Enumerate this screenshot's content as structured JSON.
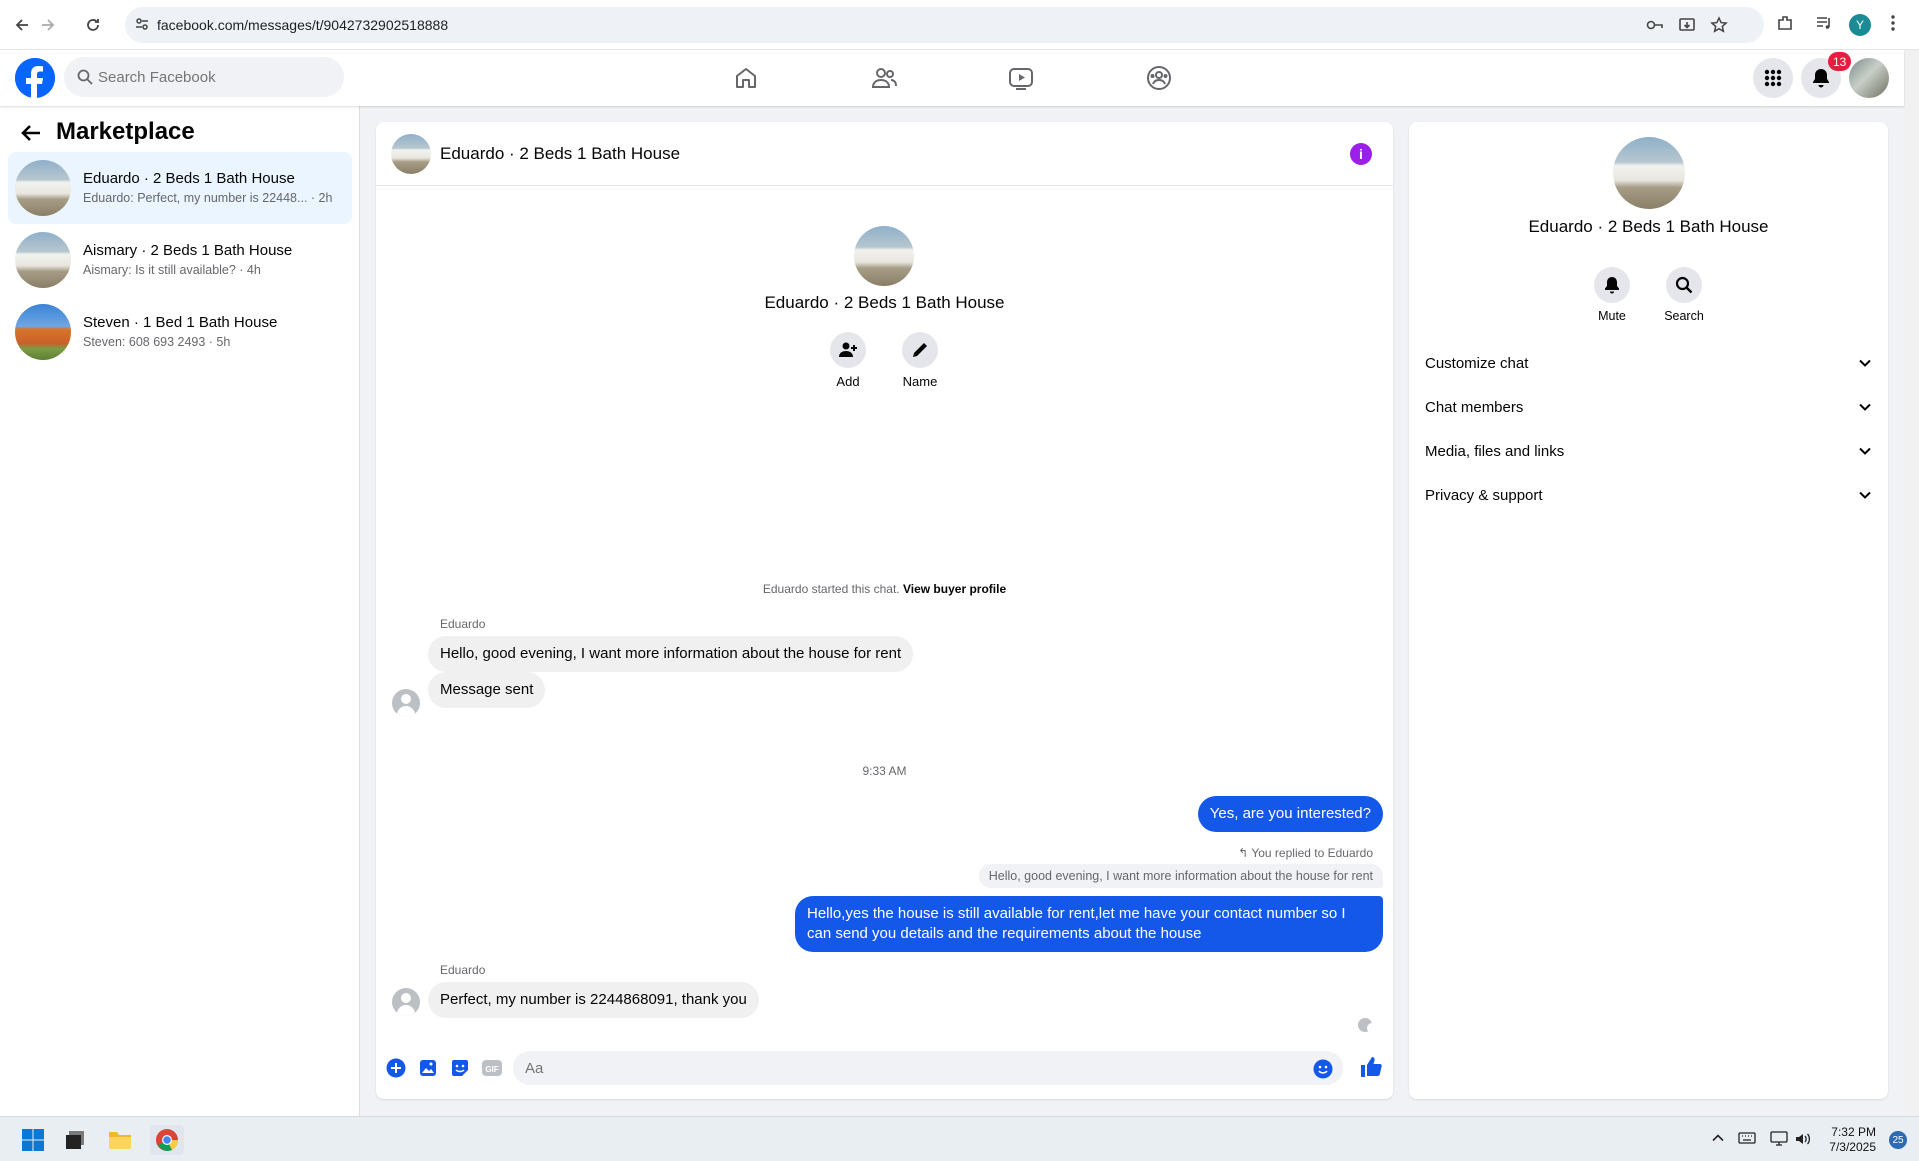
{
  "browser": {
    "url": "facebook.com/messages/t/9042732902518888",
    "profile_letter": "Y"
  },
  "header": {
    "search_placeholder": "Search Facebook",
    "notifications_count": "13"
  },
  "sidebar": {
    "title": "Marketplace",
    "conversations": [
      {
        "title": "Eduardo · 2 Beds 1 Bath House",
        "snippet": "Eduardo: Perfect, my number is 22448... · 2h",
        "active": true
      },
      {
        "title": "Aismary · 2 Beds 1 Bath House",
        "snippet": "Aismary: Is it still available? · 4h",
        "active": false
      },
      {
        "title": "Steven · 1 Bed 1 Bath House",
        "snippet": "Steven: 608 693 2493 · 5h",
        "active": false
      }
    ]
  },
  "chat": {
    "title": "Eduardo · 2 Beds 1 Bath House",
    "center_name": "Eduardo · 2 Beds 1 Bath House",
    "actions": {
      "add": "Add",
      "name": "Name"
    },
    "started_text": "Eduardo started this chat.",
    "view_profile": "View buyer profile",
    "messages": {
      "sender1": "Eduardo",
      "in1": "Hello, good evening, I want more information about the house for rent",
      "in2": "Message sent",
      "time": "9:33 AM",
      "out1": "Yes, are you interested?",
      "replied": "You replied to Eduardo",
      "quote": "Hello, good evening, I want more information about the house for rent",
      "out2": "Hello,yes the house is still available for rent,let me have your contact number   so I can send you details and the requirements about the house",
      "sender2": "Eduardo",
      "in3": "Perfect, my number is 2244868091, thank you"
    },
    "composer_placeholder": "Aa"
  },
  "details": {
    "name": "Eduardo · 2 Beds 1 Bath House",
    "mute": "Mute",
    "search": "Search",
    "sections": [
      "Customize chat",
      "Chat members",
      "Media, files and links",
      "Privacy & support"
    ]
  },
  "taskbar": {
    "time": "7:32 PM",
    "date": "7/3/2025",
    "notifications": "25"
  },
  "colors": {
    "brand": "#0866ff",
    "outgoing_bubble": "#1458ea",
    "info_icon": "#9b1fe8",
    "active_conversation": "#ebf5ff"
  }
}
